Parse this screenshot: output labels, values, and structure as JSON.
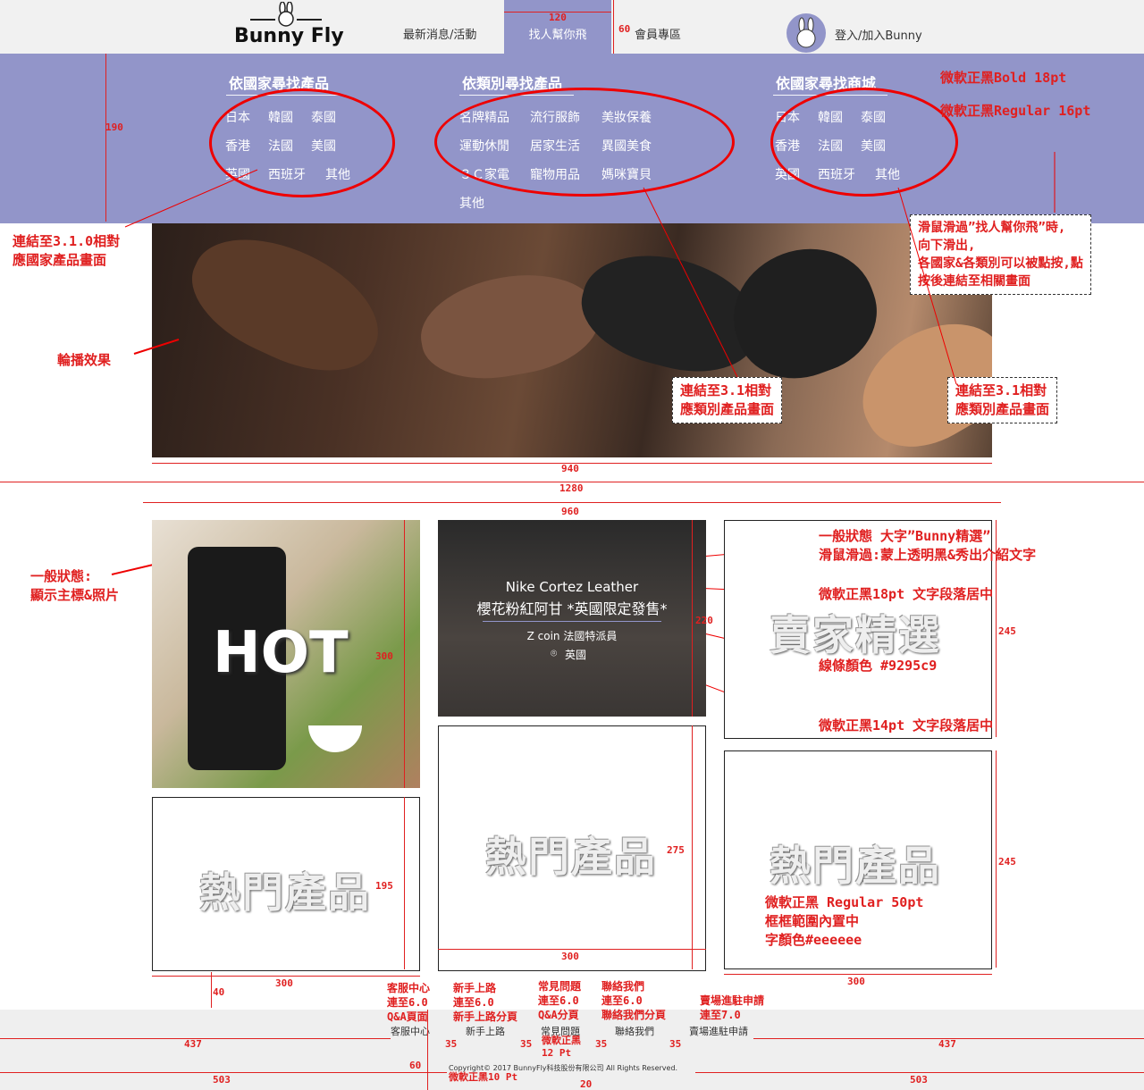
{
  "nav": {
    "logo": "Bunny Fly",
    "items": [
      "最新消息/活動",
      "找人幫你飛",
      "會員專區"
    ],
    "login": "登入/加入Bunny"
  },
  "dropdown": {
    "col1": {
      "title": "依國家尋找產品",
      "items": [
        "日本",
        "韓國",
        "泰國",
        "香港",
        "法國",
        "美國",
        "英國",
        "西班牙",
        "其他"
      ]
    },
    "col2": {
      "title": "依類別尋找產品",
      "items": [
        "名牌精品",
        "流行服飾",
        "美妝保養",
        "運動休閒",
        "居家生活",
        "異國美食",
        "３Ｃ家電",
        "寵物用品",
        "媽咪寶貝",
        "其他"
      ]
    },
    "col3": {
      "title": "依國家尋找商城",
      "items": [
        "日本",
        "韓國",
        "泰國",
        "香港",
        "法國",
        "美國",
        "英國",
        "西班牙",
        "其他"
      ]
    }
  },
  "annotations": {
    "font_bold": "微軟正黑Bold 18pt",
    "font_regular": "微軟正黑Regular 16pt",
    "link_country": "連結至3.1.0相對\n應國家產品畫面",
    "hover_desc": "滑鼠滑過”找人幫你飛”時,\n向下滑出,\n各國家&各類別可以被點按,點\n按後連結至相關畫面",
    "carousel": "輪播效果",
    "link_cat1": "連結至3.1相對\n應類別產品畫面",
    "link_cat2": "連結至3.1相對\n應類別產品畫面",
    "normal_state": "一般狀態:\n顯示主標&照片",
    "bunny_pick": "一般狀態 大字”Bunny精選”\n滑鼠滑過:蒙上透明黑&秀出介紹文字",
    "font18": "微軟正黑18pt 文字段落居中",
    "line_color": "線條顏色 #9295c9",
    "font14": "微軟正黑14pt 文字段落居中",
    "card_font": "微軟正黑 Regular 50pt\n框框範圍內置中\n字顏色#eeeeee"
  },
  "dims": {
    "w120": "120",
    "h60": "60",
    "h190": "190",
    "w940": "940",
    "w1280": "1280",
    "w960": "960",
    "h300": "300",
    "h220": "220",
    "h245a": "245",
    "h195": "195",
    "h275": "275",
    "h245b": "245",
    "w300a": "300",
    "w300b": "300",
    "w300c": "300",
    "h40": "40",
    "f437a": "437",
    "f437b": "437",
    "f35a": "35",
    "f35b": "35",
    "f35c": "35",
    "f35d": "35",
    "f503a": "503",
    "f503b": "503",
    "f60": "60",
    "f20": "20"
  },
  "cards": {
    "hot": "HOT",
    "promo_title": "Nike Cortez Leather",
    "promo_sub": "櫻花粉紅阿甘 *英國限定發售*",
    "promo_seller": "Z coin 法國特派員",
    "promo_loc": "英國",
    "seller_pick": "賣家精選",
    "hot1": "熱門產品",
    "hot2": "熱門產品",
    "hot3": "熱門產品"
  },
  "footer": {
    "links": [
      "客服中心",
      "新手上路",
      "常見問題",
      "聯絡我們",
      "賣場進駐申請"
    ],
    "copyright": "Copyright© 2017 BunnyFly科技股份有限公司 All Rights Reserved.",
    "notes": {
      "n1": "客服中心\n連至6.0\nQ&A頁面",
      "n2": "新手上路\n連至6.0\n新手上路分頁",
      "n3": "常見問題\n連至6.0\nQ&A分頁",
      "n4": "聯絡我們\n連至6.0\n聯絡我們分頁",
      "n5": "賣場進駐申請\n連至7.0",
      "n6": "微軟正黑\n12 Pt",
      "n7": "微軟正黑10 Pt"
    }
  },
  "colors": {
    "accent": "#9295c9",
    "annotation": "#e02020"
  }
}
